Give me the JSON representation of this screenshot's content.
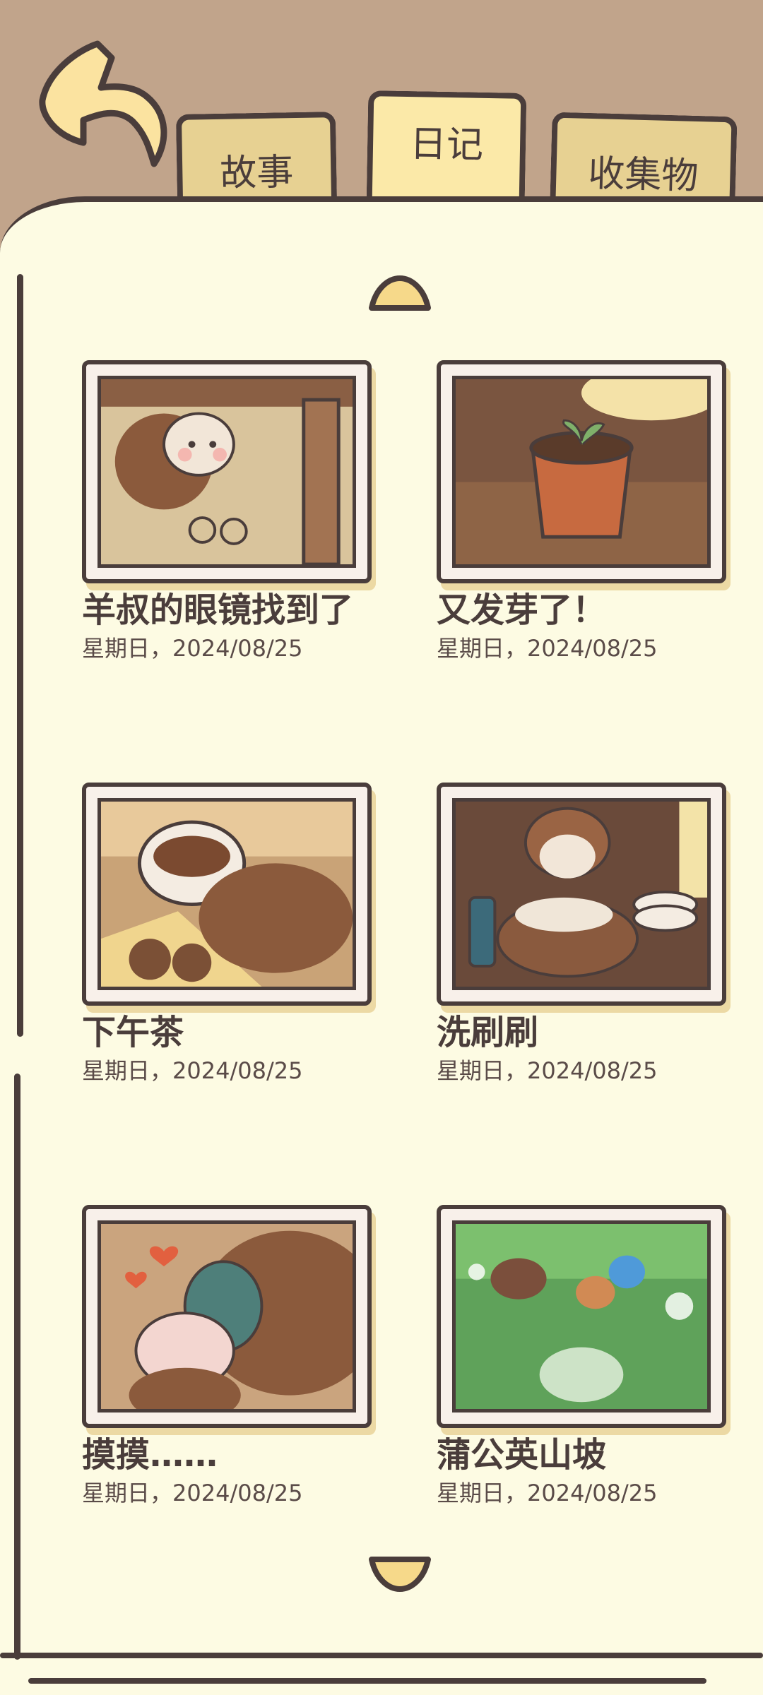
{
  "tabs": [
    {
      "label": "故事",
      "active": false
    },
    {
      "label": "日记",
      "active": true
    },
    {
      "label": "收集物",
      "active": false
    }
  ],
  "colors": {
    "background": "#c1a48b",
    "page": "#fdfbe3",
    "ink": "#4a3d3b",
    "tab_inactive": "#e7d192",
    "tab_active": "#fbe9a8"
  },
  "entries": [
    {
      "title": "羊叔的眼镜找到了",
      "date": "星期日，2024/08/25",
      "image": "bear-finds-glasses-illustration"
    },
    {
      "title": "又发芽了！",
      "date": "星期日，2024/08/25",
      "image": "sprouting-flowerpot-illustration"
    },
    {
      "title": "下午茶",
      "date": "星期日，2024/08/25",
      "image": "afternoon-tea-illustration"
    },
    {
      "title": "洗刷刷",
      "date": "星期日，2024/08/25",
      "image": "washing-dishes-illustration"
    },
    {
      "title": "摸摸……",
      "date": "星期日，2024/08/25",
      "image": "petting-illustration"
    },
    {
      "title": "蒲公英山坡",
      "date": "星期日，2024/08/25",
      "image": "dandelion-hill-illustration"
    }
  ]
}
